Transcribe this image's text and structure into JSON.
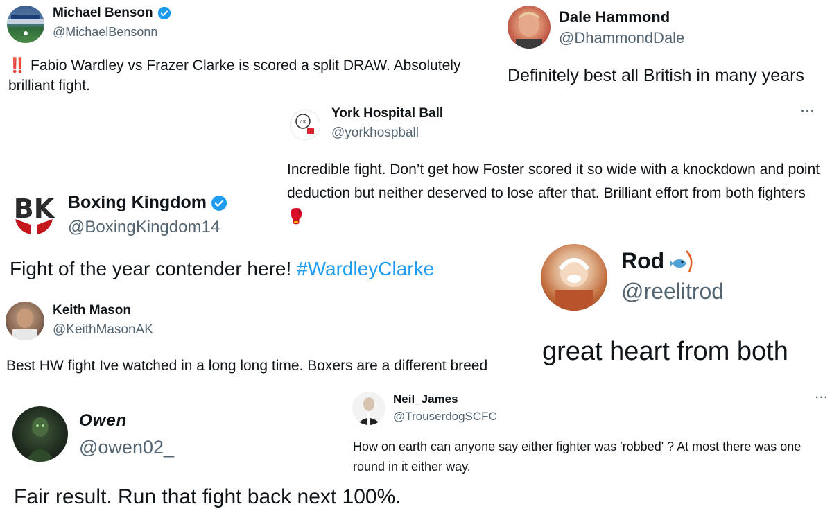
{
  "tweets": {
    "michael": {
      "name": "Michael Benson",
      "handle": "@MichaelBensonn",
      "emoji": "‼️",
      "text": "Fabio Wardley vs Frazer Clarke is scored a split DRAW. Absolutely brilliant fight."
    },
    "dale": {
      "name": "Dale Hammond",
      "handle": "@DhammondDale",
      "text": "Definitely best all British in many years"
    },
    "york": {
      "name": "York Hospital Ball",
      "handle": "@yorkhospball",
      "text": "Incredible fight. Don’t get how Foster scored it so wide with a knockdown and point deduction but neither deserved to lose after that. Brilliant effort from both fighters",
      "emoji": "🥊",
      "more": "···"
    },
    "boxing": {
      "name": "Boxing Kingdom",
      "handle": "@BoxingKingdom14",
      "text": "Fight of the year contender here!",
      "hashtag": "#WardleyClarke",
      "logo_text": "BK"
    },
    "rod": {
      "name": "Rod",
      "handle": "@reelitrod",
      "text": "great heart from both"
    },
    "keith": {
      "name": "Keith Mason",
      "handle": "@KeithMasonAK",
      "text": "Best HW fight Ive watched in a long long time. Boxers are a different breed"
    },
    "neil": {
      "name": "Neil_James",
      "handle": "@TrouserdogSCFC",
      "text": "How on earth can anyone say either fighter was 'robbed' ? At most there was one round in it either way.",
      "more": "···"
    },
    "owen": {
      "name": "Owen",
      "handle": "@owen02_",
      "text": "Fair result. Run that fight back next 100%."
    }
  },
  "colors": {
    "text": "#0f1419",
    "muted": "#536471",
    "verified": "#1d9bf0",
    "hashtag": "#1d9bf0"
  }
}
